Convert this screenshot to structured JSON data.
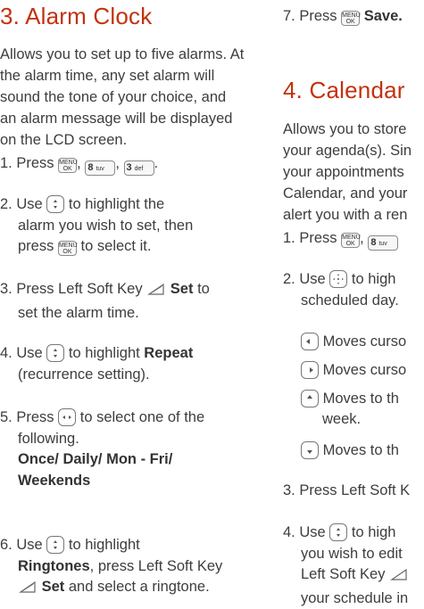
{
  "left": {
    "title": "3. Alarm Clock",
    "intro": "Allows you to set up to five alarms. At the alarm time, any set alarm will sound the tone of your choice, and an alarm message will be displayed on the LCD screen.",
    "s1": {
      "num": "1.",
      "text": "Press",
      "sep1": ",",
      "sep2": ",",
      "end": "."
    },
    "s2": {
      "num": "2.",
      "a": "Use",
      "b": "to highlight the",
      "c": "alarm you wish to set, then",
      "d": "press",
      "e": "to select it."
    },
    "s3": {
      "num": "3.",
      "a": "Press Left Soft Key",
      "b": "Set",
      "c": "to",
      "d": "set the alarm time."
    },
    "s4": {
      "num": "4.",
      "a": "Use",
      "b": "to highlight",
      "c": "Repeat",
      "d": "(recurrence setting)."
    },
    "s5": {
      "num": "5.",
      "a": "Press",
      "b": "to select one of the",
      "c": "following.",
      "o1": "Once",
      "o2": "Daily",
      "o3": "Mon - Fri",
      "o4": "Weekends",
      "slash": "/"
    },
    "s6": {
      "num": "6.",
      "a": "Use",
      "b": "to highlight",
      "c": "Ringtones",
      "d": ", press Left Soft Key",
      "e": "Set",
      "f": "and select a ringtone."
    }
  },
  "right": {
    "s7": {
      "num": "7.",
      "a": "Press",
      "b": "Save."
    },
    "title": "4. Calendar",
    "intro_l1": "Allows you to store",
    "intro_l2": "your agenda(s). Sin",
    "intro_l3": "your appointments",
    "intro_l4": "Calendar, and your",
    "intro_l5": "alert you with a ren",
    "s1": {
      "num": "1.",
      "a": "Press",
      "sep": ","
    },
    "s2": {
      "num": "2.",
      "a": "Use",
      "b": "to high",
      "c": "scheduled day."
    },
    "sub1": "Moves curso",
    "sub2": "Moves curso",
    "sub3a": "Moves to th",
    "sub3b": "week.",
    "sub4": "Moves to th",
    "s3": "3. Press Left Soft K",
    "s4": {
      "num": "4.",
      "a": "Use",
      "b": "to high",
      "c": "you wish to edit",
      "d": "Left Soft Key",
      "e": "your schedule in"
    }
  },
  "keys": {
    "menu_top": "MENU",
    "menu_bottom": "OK",
    "k8": "8",
    "k8_letters": "tuv",
    "k3": "3",
    "k3_letters": "def"
  },
  "colors": {
    "heading": "#c2320f",
    "text": "#3d3d3d"
  }
}
